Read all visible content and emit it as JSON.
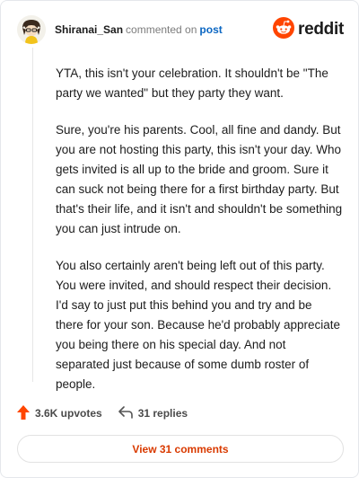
{
  "header": {
    "username": "Shiranai_San",
    "action": "commented on",
    "post_link": "post",
    "brand": "reddit"
  },
  "comment": {
    "paragraphs": [
      "YTA, this isn't your celebration. It shouldn't be \"The party we wanted\" but they party they want.",
      "Sure, you're his parents. Cool, all fine and dandy. But you are not hosting this party, this isn't your day. Who gets invited is all up to the bride and groom. Sure it can suck not being there for a first birthday party. But that's their life, and it isn't and shouldn't be something you can just intrude on.",
      "You also certainly aren't being left out of this party. You were invited, and should respect their decision. I'd say to just put this behind you and try and be there for your son. Because he'd probably appreciate you being there on his special day. And not separated just because of some dumb roster of people."
    ]
  },
  "footer": {
    "upvotes": "3.6K upvotes",
    "replies": "31 replies",
    "view_button": "View 31 comments"
  },
  "icons": {
    "avatar": "cartoon-avatar",
    "brand_logo": "reddit-snoo-icon",
    "upvote": "upvote-arrow-icon",
    "reply": "reply-arrow-icon"
  },
  "colors": {
    "brand_orange": "#ff4500",
    "link_blue": "#0a66c2",
    "button_text": "#d93a00"
  }
}
